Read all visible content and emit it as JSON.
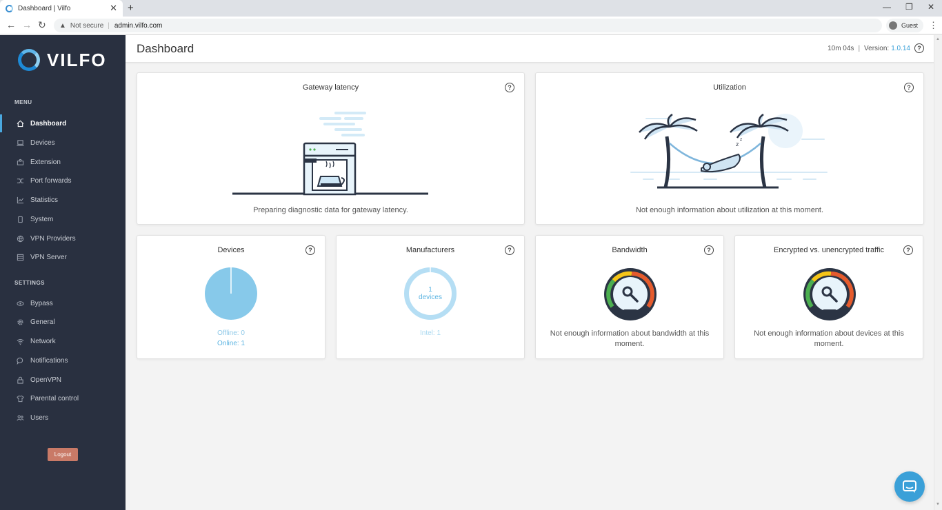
{
  "browser": {
    "tab_title": "Dashboard | Vilfo",
    "tab_close": "✕",
    "new_tab": "+",
    "minimize": "—",
    "restore": "❐",
    "close": "✕",
    "back": "←",
    "forward": "→",
    "reload": "↻",
    "warning_icon": "▲",
    "not_secure": "Not secure",
    "separator": "|",
    "url": "admin.vilfo.com",
    "guest_label": "Guest",
    "menu": "⋮"
  },
  "sidebar": {
    "logo_text": "VILFO",
    "menu_heading": "MENU",
    "menu_items": [
      {
        "label": "Dashboard",
        "icon": "home-icon",
        "active": true
      },
      {
        "label": "Devices",
        "icon": "laptop-icon"
      },
      {
        "label": "Extension",
        "icon": "extension-icon"
      },
      {
        "label": "Port forwards",
        "icon": "shuffle-icon"
      },
      {
        "label": "Statistics",
        "icon": "chart-icon"
      },
      {
        "label": "System",
        "icon": "chip-icon"
      },
      {
        "label": "VPN Providers",
        "icon": "globe-icon"
      },
      {
        "label": "VPN Server",
        "icon": "server-icon"
      }
    ],
    "settings_heading": "SETTINGS",
    "settings_items": [
      {
        "label": "Bypass",
        "icon": "bypass-icon"
      },
      {
        "label": "General",
        "icon": "gear-icon"
      },
      {
        "label": "Network",
        "icon": "wifi-icon"
      },
      {
        "label": "Notifications",
        "icon": "chat-bubble-icon"
      },
      {
        "label": "OpenVPN",
        "icon": "lock-icon"
      },
      {
        "label": "Parental control",
        "icon": "shirt-icon"
      },
      {
        "label": "Users",
        "icon": "users-icon"
      }
    ],
    "logout_label": "Logout"
  },
  "header": {
    "title": "Dashboard",
    "uptime": "10m 04s",
    "separator": "|",
    "version_label": "Version:",
    "version_value": "1.0.14",
    "help": "?"
  },
  "cards": {
    "gateway": {
      "title": "Gateway latency",
      "message": "Preparing diagnostic data for gateway latency.",
      "help": "?"
    },
    "utilization": {
      "title": "Utilization",
      "message": "Not enough information about utilization at this moment.",
      "help": "?"
    },
    "devices": {
      "title": "Devices",
      "offline": "Offline: 0",
      "online": "Online: 1",
      "help": "?"
    },
    "manufacturers": {
      "title": "Manufacturers",
      "center_count": "1",
      "center_label": "devices",
      "legend": "Intel: 1",
      "help": "?"
    },
    "bandwidth": {
      "title": "Bandwidth",
      "message": "Not enough information about bandwidth at this moment.",
      "help": "?"
    },
    "encrypted": {
      "title": "Encrypted vs. unencrypted traffic",
      "message": "Not enough information about devices at this moment.",
      "help": "?"
    }
  },
  "chart_data": [
    {
      "type": "pie",
      "categories": [
        "Offline",
        "Online"
      ],
      "values": [
        0,
        1
      ]
    },
    {
      "type": "pie",
      "categories": [
        "Intel"
      ],
      "values": [
        1
      ]
    }
  ],
  "colors": {
    "sidebar_bg": "#293040",
    "accent": "#3aa0d8",
    "pie_fill": "#87c9ea",
    "donut": "#b5def4",
    "logout": "#c97a67"
  }
}
